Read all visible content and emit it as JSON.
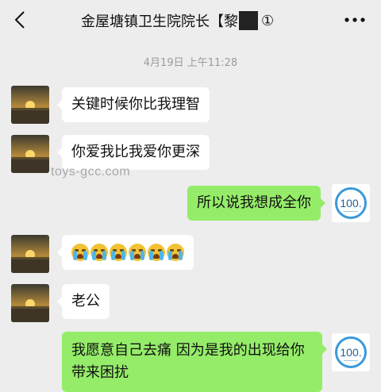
{
  "header": {
    "title": "金屋塘镇卫生院院长【黎",
    "title_suffix": "①",
    "back_icon": "chevron-left-icon",
    "more_icon": "more-dots-icon"
  },
  "timestamp": "4月19日 上午11:28",
  "watermark": "toys-gcc.com",
  "my_avatar_text": "100.",
  "messages": [
    {
      "side": "in",
      "text": "关键时候你比我理智"
    },
    {
      "side": "in",
      "text": "你爱我比我爱你更深"
    },
    {
      "side": "out",
      "text": "所以说我想成全你"
    },
    {
      "side": "in",
      "text": "",
      "emoji": "crying-face-emoji",
      "emoji_count": 6
    },
    {
      "side": "in",
      "text": "老公"
    },
    {
      "side": "out",
      "text": "我愿意自己去痛  因为是我的出现给你带来困扰"
    }
  ],
  "colors": {
    "background": "#ededed",
    "incoming_bubble": "#ffffff",
    "outgoing_bubble": "#95ec69",
    "avatar_ring": "#3a9ad9"
  }
}
